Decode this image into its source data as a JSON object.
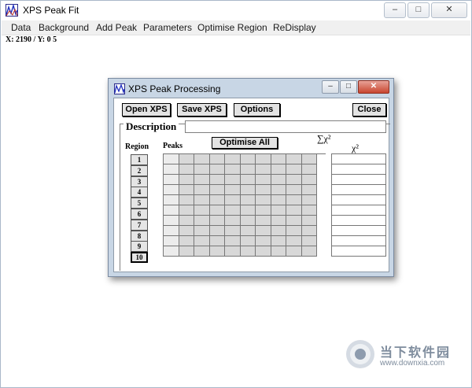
{
  "app": {
    "title": "XPS Peak Fit"
  },
  "window_controls": {
    "minimize": "–",
    "maximize": "□",
    "close": "✕"
  },
  "menu": {
    "items": [
      "Data",
      "Background",
      "Add Peak",
      "Parameters",
      "Optimise Region",
      "ReDisplay"
    ]
  },
  "status": {
    "coords": "X: 2190 / Y: 0   5"
  },
  "dialog": {
    "title": "XPS Peak Processing",
    "controls": {
      "minimize": "–",
      "maximize": "□",
      "close": "✕"
    },
    "buttons": {
      "open": "Open XPS",
      "save": "Save XPS",
      "options": "Options",
      "close": "Close",
      "optimise_all": "Optimise All"
    },
    "description_label": "Description",
    "description_value": "",
    "region_label": "Region",
    "peaks_label": "Peaks",
    "sum_chi_label": "∑χ²",
    "chi_label": "χ²",
    "regions": [
      "1",
      "2",
      "3",
      "4",
      "5",
      "6",
      "7",
      "8",
      "9",
      "10"
    ],
    "active_region": "10",
    "peak_columns": 10
  },
  "watermark": {
    "line1": "当下软件园",
    "line2": "www.downxia.com"
  },
  "colors": {
    "dialog_frame": "#c8d6e5",
    "close_red": "#c8452f",
    "watermark": "#7e8c9d"
  }
}
